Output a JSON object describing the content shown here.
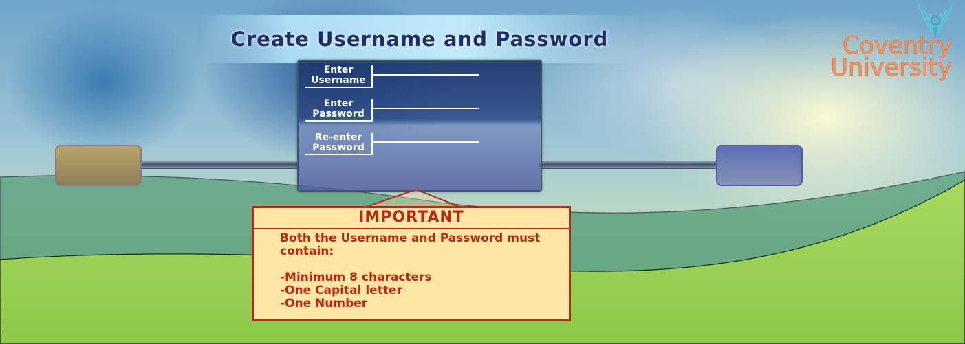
{
  "title": "Create Username and Password",
  "form": {
    "username_label_line1": "Enter",
    "username_label_line2": "Username",
    "password_label_line1": "Enter",
    "password_label_line2": "Password",
    "reenter_label_line1": "Re-enter",
    "reenter_label_line2": "Password",
    "username_value": "",
    "password_value": "",
    "reenter_value": ""
  },
  "notice": {
    "title": "IMPORTANT",
    "line1": "Both the Username and Password must",
    "line2": "contain:",
    "req1": "-Minimum 8 characters",
    "req2": "-One Capital letter",
    "req3": "-One Number"
  },
  "logo": {
    "line1": "Coventry",
    "line2": "University",
    "icon": "phoenix-icon"
  },
  "buttons": {
    "left_icon": "left-nav-button",
    "right_icon": "right-nav-button"
  },
  "colors": {
    "title": "#1c2f6a",
    "notice_bg": "#ffe6a6",
    "notice_accent": "#b32a16",
    "logo": "#f19a6a"
  }
}
